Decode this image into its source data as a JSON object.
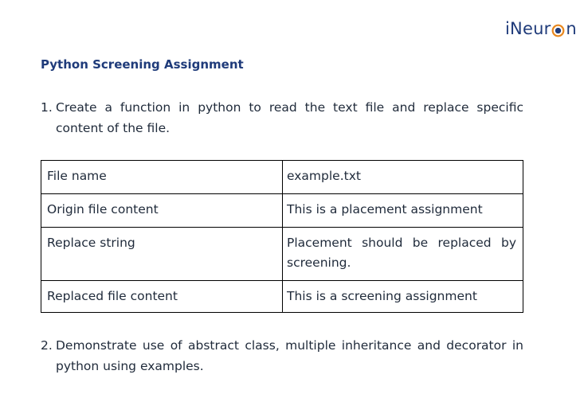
{
  "logo": {
    "prefix": "iNeur",
    "suffix": "n",
    "colors": {
      "text": "#1f3b7a",
      "ring": "#e8871e",
      "core": "#1f3b7a"
    }
  },
  "title": "Python Screening Assignment",
  "questions": [
    {
      "number": "1.",
      "text": "Create a function in python to read the text file and replace specific content of the file."
    },
    {
      "number": "2.",
      "text": "Demonstrate use of abstract class, multiple inheritance and decorator in python using examples."
    }
  ],
  "table": {
    "rows": [
      {
        "label": "File name",
        "value": "example.txt"
      },
      {
        "label": "Origin file content",
        "value": "This is a placement assignment"
      },
      {
        "label": "Replace string",
        "value": "Placement should be replaced by screening."
      },
      {
        "label": "Replaced file content",
        "value": "This is a screening assignment"
      }
    ]
  }
}
